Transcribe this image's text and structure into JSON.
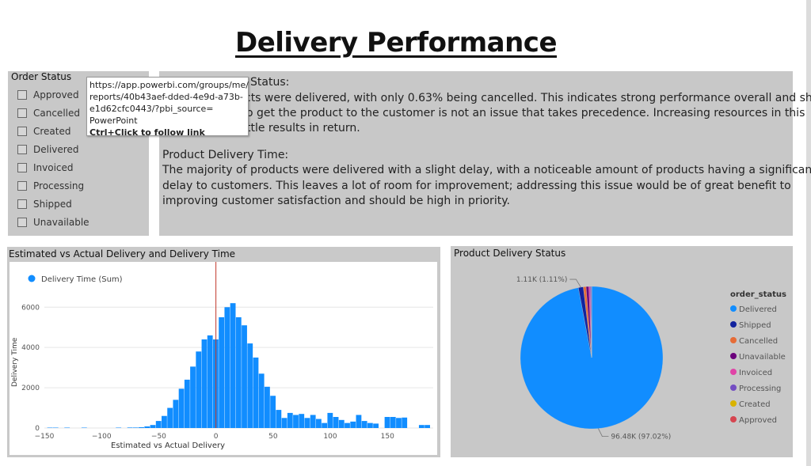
{
  "page": {
    "title": "Delivery Performance"
  },
  "slicer": {
    "header": "Order Status",
    "options": [
      "Approved",
      "Cancelled",
      "Created",
      "Delivered",
      "Invoiced",
      "Processing",
      "Shipped",
      "Unavailable"
    ]
  },
  "textbox": {
    "line1": "Status:",
    "line2": "cts were delivered, with only 0.63% being cancelled. This indicates strong performance overall and shows",
    "line3": "o get the product to the customer is not an issue that takes precedence. Increasing resources in this",
    "line4": "ttle results in return.",
    "line5": "Product Delivery Time:",
    "line6": "The majority of products were delivered with a slight delay, with a noticeable amount of products having a significant",
    "line7": "delay to customers. This leaves a lot of room for improvement; addressing this issue would be of great benefit to",
    "line8": "improving customer satisfaction and should be high in priority."
  },
  "tooltip": {
    "url_line1": "https://app.powerbi.com/groups/me/",
    "url_line2": "reports/40b43aef-dded-4e9d-a73b-",
    "url_line3": "e1d62cfc0443/?pbi_source=",
    "url_line4": "PowerPoint",
    "hint": "Ctrl+Click to follow link"
  },
  "chart_data": [
    {
      "type": "bar",
      "title": "Estimated vs Actual Delivery and Delivery Time",
      "legend": "Delivery Time (Sum)",
      "legend_position": "top-left",
      "xlabel": "Estimated vs Actual Delivery",
      "ylabel": "Delivery Time",
      "xlim": [
        -150,
        190
      ],
      "ylim": [
        0,
        6600
      ],
      "xticks": [
        "−150",
        "−100",
        "−50",
        "0",
        "50",
        "100",
        "150"
      ],
      "yticks": [
        "0",
        "2000",
        "4000",
        "6000"
      ],
      "color": "#118DFF",
      "reference_line_x": 0,
      "reference_line_color": "#c0392b",
      "bin_width": 5,
      "bins": [
        {
          "x": -145,
          "y": 20
        },
        {
          "x": -140,
          "y": 20
        },
        {
          "x": -130,
          "y": 20
        },
        {
          "x": -115,
          "y": 20
        },
        {
          "x": -85,
          "y": 20
        },
        {
          "x": -75,
          "y": 25
        },
        {
          "x": -70,
          "y": 25
        },
        {
          "x": -65,
          "y": 40
        },
        {
          "x": -60,
          "y": 80
        },
        {
          "x": -55,
          "y": 150
        },
        {
          "x": -50,
          "y": 350
        },
        {
          "x": -45,
          "y": 600
        },
        {
          "x": -40,
          "y": 1000
        },
        {
          "x": -35,
          "y": 1400
        },
        {
          "x": -30,
          "y": 1950
        },
        {
          "x": -25,
          "y": 2400
        },
        {
          "x": -20,
          "y": 3050
        },
        {
          "x": -15,
          "y": 3800
        },
        {
          "x": -10,
          "y": 4400
        },
        {
          "x": -5,
          "y": 4600
        },
        {
          "x": 0,
          "y": 4400
        },
        {
          "x": 5,
          "y": 5500
        },
        {
          "x": 10,
          "y": 6000
        },
        {
          "x": 15,
          "y": 6200
        },
        {
          "x": 20,
          "y": 5500
        },
        {
          "x": 25,
          "y": 5100
        },
        {
          "x": 30,
          "y": 4200
        },
        {
          "x": 35,
          "y": 3500
        },
        {
          "x": 40,
          "y": 2700
        },
        {
          "x": 45,
          "y": 2050
        },
        {
          "x": 50,
          "y": 1600
        },
        {
          "x": 55,
          "y": 900
        },
        {
          "x": 60,
          "y": 500
        },
        {
          "x": 65,
          "y": 750
        },
        {
          "x": 70,
          "y": 650
        },
        {
          "x": 75,
          "y": 700
        },
        {
          "x": 80,
          "y": 500
        },
        {
          "x": 85,
          "y": 650
        },
        {
          "x": 90,
          "y": 450
        },
        {
          "x": 95,
          "y": 250
        },
        {
          "x": 100,
          "y": 750
        },
        {
          "x": 105,
          "y": 550
        },
        {
          "x": 110,
          "y": 400
        },
        {
          "x": 115,
          "y": 250
        },
        {
          "x": 120,
          "y": 320
        },
        {
          "x": 125,
          "y": 650
        },
        {
          "x": 130,
          "y": 350
        },
        {
          "x": 135,
          "y": 250
        },
        {
          "x": 140,
          "y": 220
        },
        {
          "x": 150,
          "y": 550
        },
        {
          "x": 155,
          "y": 550
        },
        {
          "x": 160,
          "y": 500
        },
        {
          "x": 165,
          "y": 520
        },
        {
          "x": 180,
          "y": 150
        },
        {
          "x": 185,
          "y": 150
        }
      ]
    },
    {
      "type": "pie",
      "title": "Product Delivery Status",
      "legend_title": "order_status",
      "legend_position": "right",
      "categories": [
        "Delivered",
        "Shipped",
        "Cancelled",
        "Unavailable",
        "Invoiced",
        "Processing",
        "Created",
        "Approved"
      ],
      "values": [
        96480,
        1107,
        625,
        609,
        314,
        301,
        5,
        2
      ],
      "colors": [
        "#118DFF",
        "#12239E",
        "#E66C37",
        "#6B007B",
        "#E044A7",
        "#744EC2",
        "#D9B300",
        "#D64550"
      ],
      "labels": [
        {
          "category": "Shipped",
          "text": "1.11K (1.11%)"
        },
        {
          "category": "Delivered",
          "text": "96.48K (97.02%)"
        }
      ]
    }
  ]
}
